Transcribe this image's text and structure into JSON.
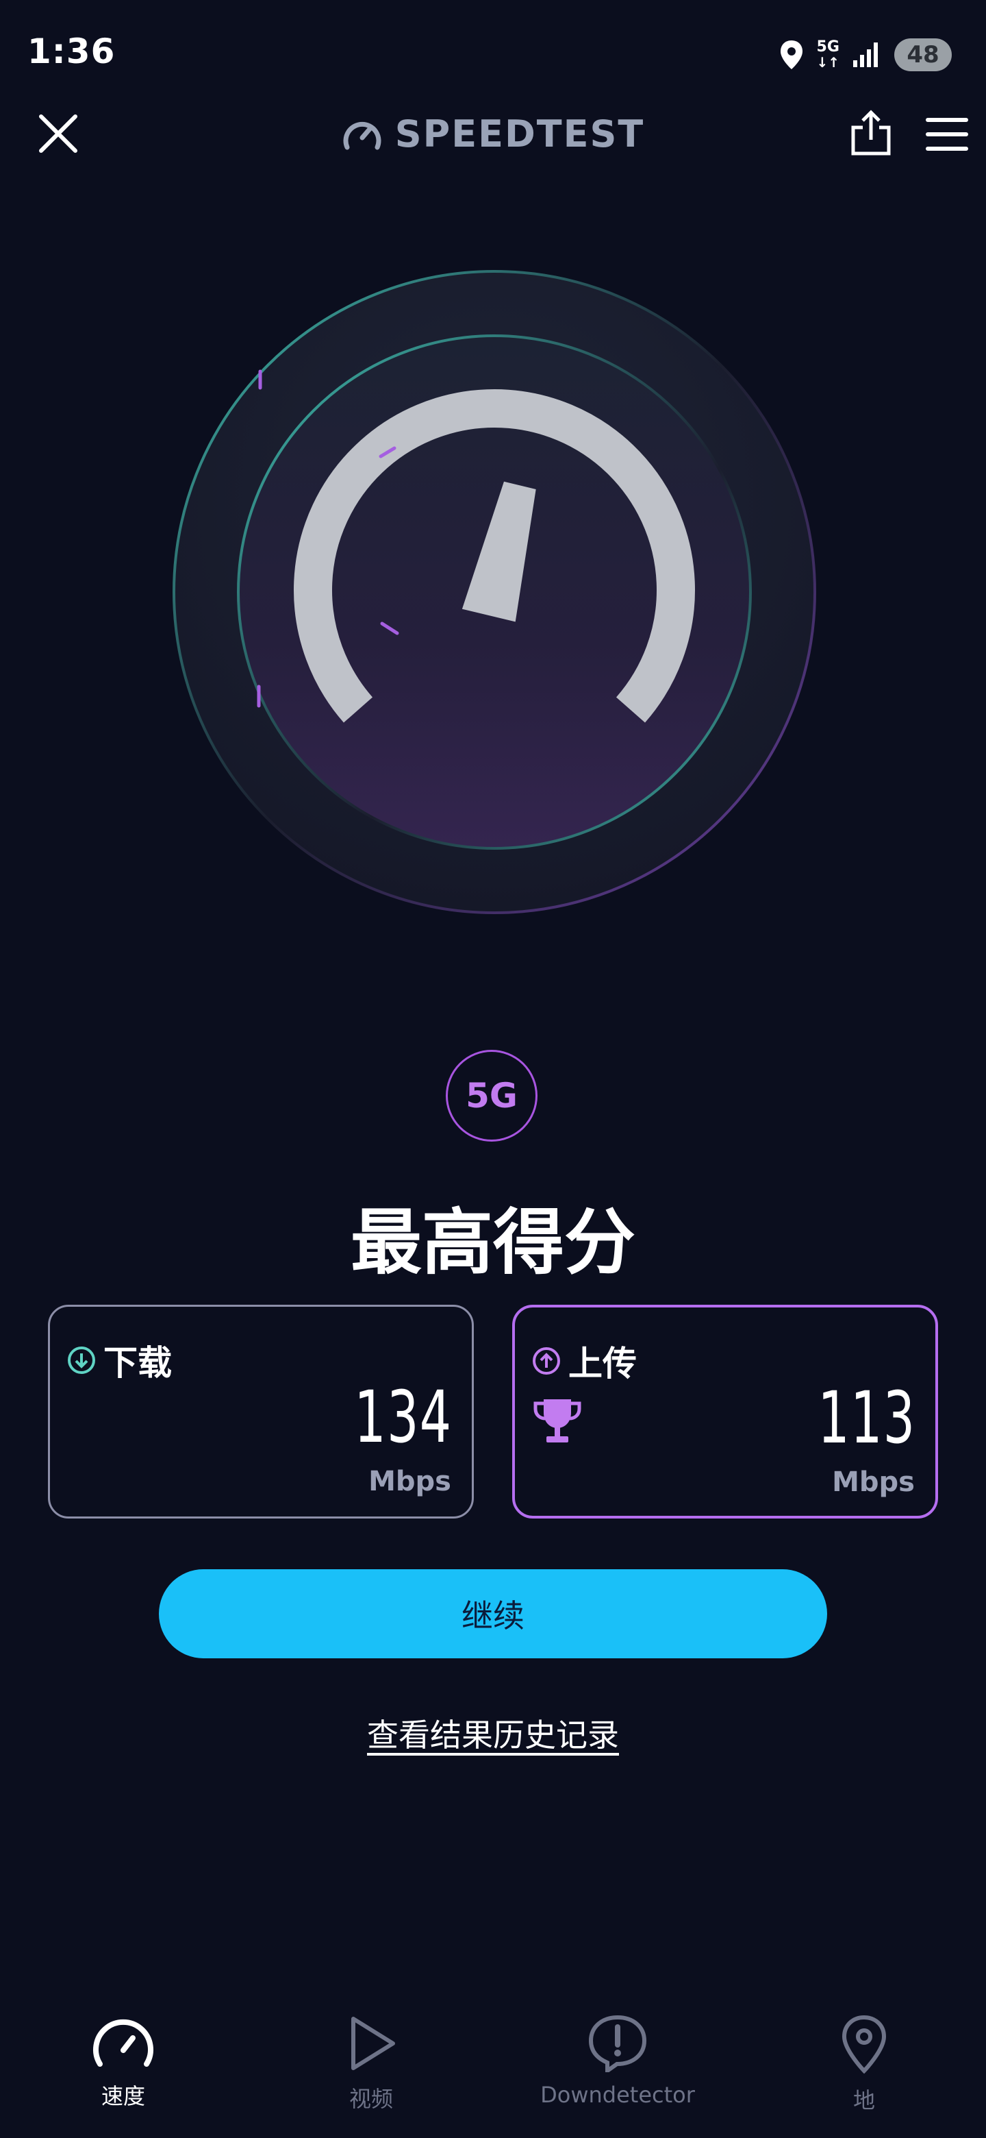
{
  "status_bar": {
    "time": "1:36",
    "network": "5G",
    "battery": "48"
  },
  "header": {
    "brand": "SPEEDTEST"
  },
  "gauge": {
    "needle_fraction": 0.55
  },
  "connection_badge": "5G",
  "headline": "最高得分",
  "download": {
    "label": "下载",
    "value": "134",
    "unit": "Mbps"
  },
  "upload": {
    "label": "上传",
    "value": "113",
    "unit": "Mbps"
  },
  "continue_label": "继续",
  "history_link": "查看结果历史记录",
  "nav": [
    {
      "label": "速度",
      "icon": "speedometer-icon",
      "active": true
    },
    {
      "label": "视频",
      "icon": "play-icon",
      "active": false
    },
    {
      "label": "Downdetector",
      "icon": "alert-icon",
      "active": false
    },
    {
      "label": "地",
      "icon": "map-pin-icon",
      "active": false
    }
  ],
  "colors": {
    "accent_cyan": "#1ac0f8",
    "accent_purple": "#b56ef0",
    "background": "#0b0e1e"
  }
}
